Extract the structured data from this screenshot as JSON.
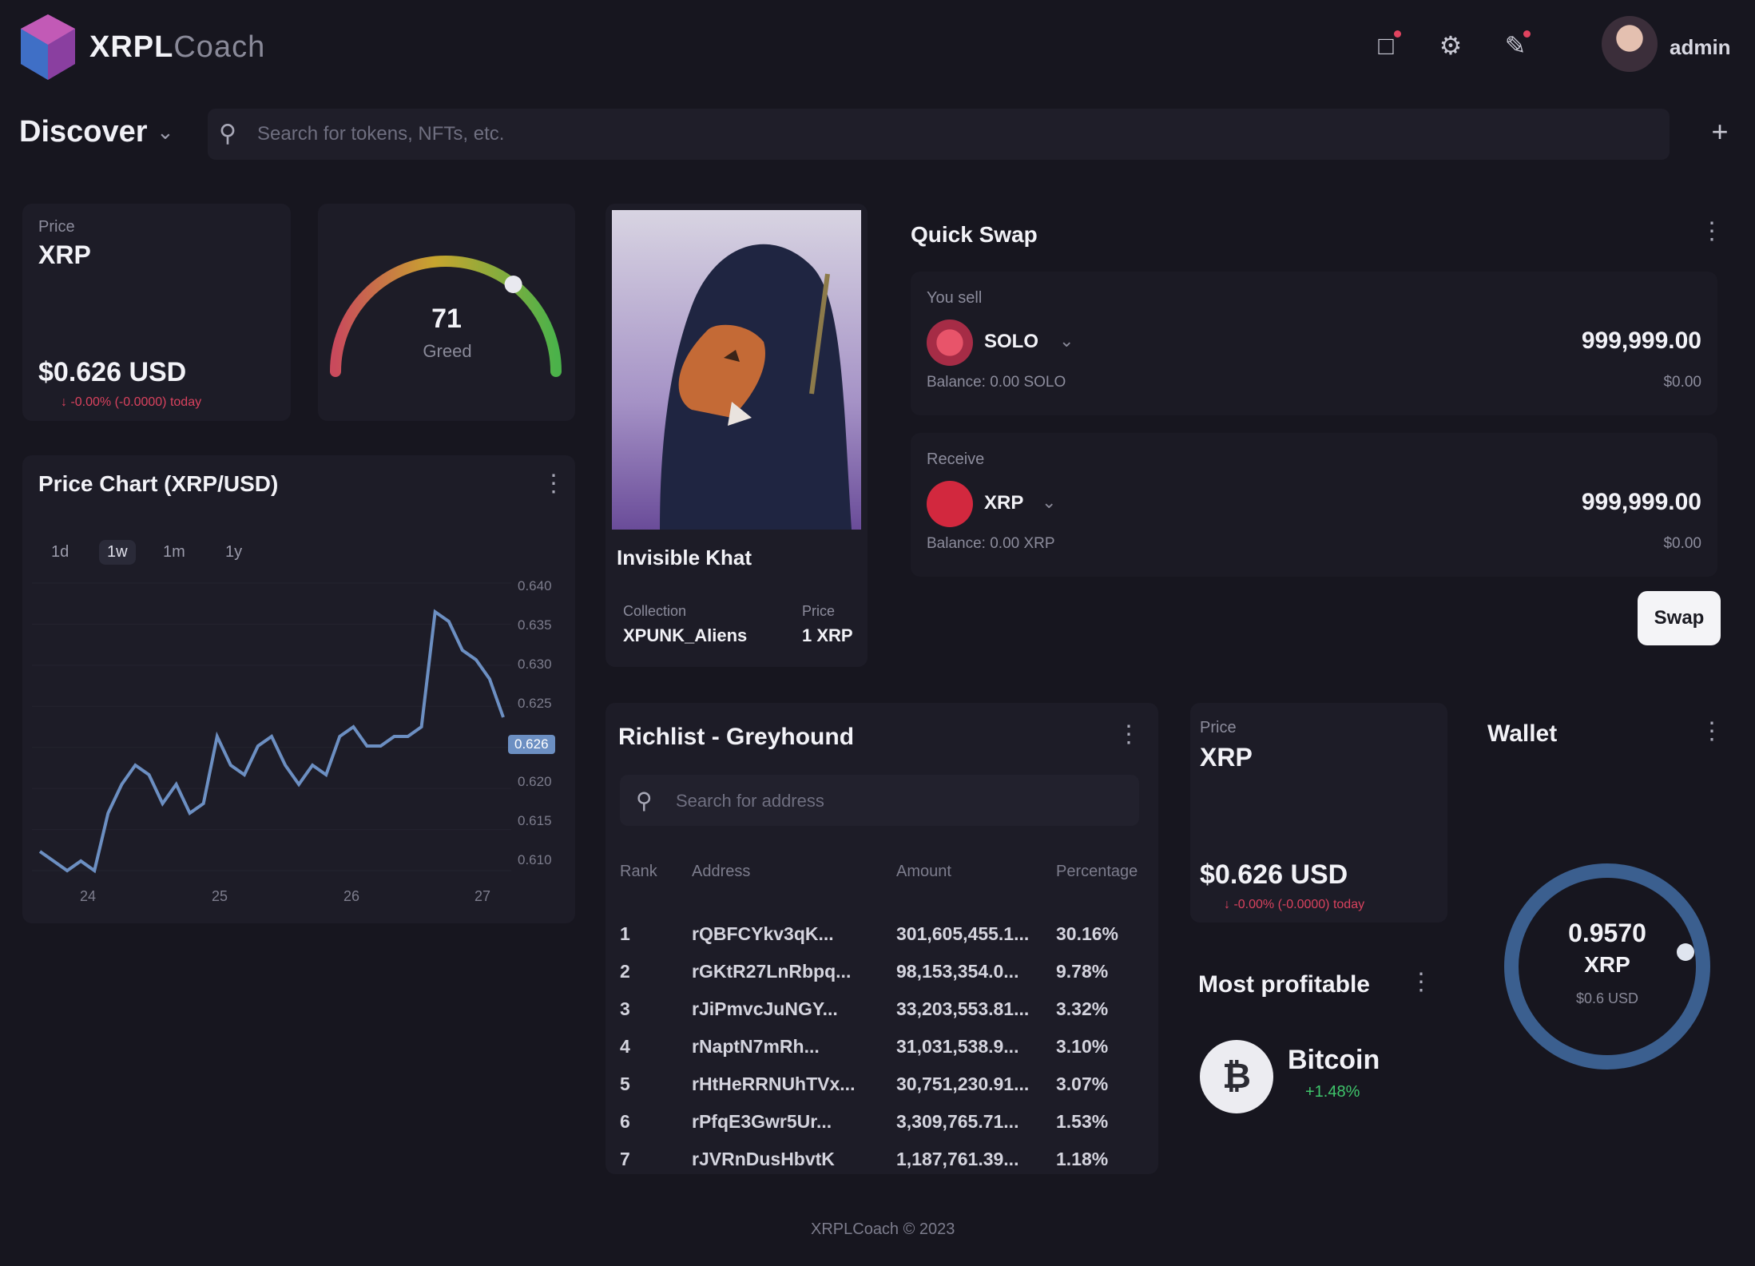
{
  "header": {
    "brand_bold": "XRPL",
    "brand_light": "Coach",
    "username": "admin",
    "icons": [
      "notification-icon",
      "settings-icon",
      "edit-icon"
    ]
  },
  "subbar": {
    "discover_label": "Discover",
    "search_placeholder": "Search for tokens, NFTs, etc."
  },
  "price_card": {
    "label": "Price",
    "symbol": "XRP",
    "value": "$0.626 USD",
    "change": "↓ -0.00% (-0.0000) today"
  },
  "gauge": {
    "value": "71",
    "label": "Greed",
    "level": 0.71
  },
  "price_chart": {
    "title": "Price Chart (XRP/USD)",
    "timeframes": [
      "1d",
      "1w",
      "1m",
      "1y"
    ],
    "active_timeframe": "1w",
    "y_ticks": [
      "0.640",
      "0.635",
      "0.630",
      "0.625",
      "0.626",
      "0.620",
      "0.615",
      "0.610"
    ],
    "highlight_value": "0.626",
    "x_ticks": [
      "24",
      "25",
      "26",
      "27"
    ],
    "color": "#6c8fc2"
  },
  "chart_data": {
    "type": "line",
    "x": [
      0,
      1,
      2,
      3,
      4,
      5,
      6,
      7,
      8,
      9,
      10,
      11,
      12,
      13,
      14,
      15,
      16,
      17,
      18,
      19,
      20,
      21,
      22,
      23,
      24,
      25,
      26,
      27,
      28,
      29,
      30,
      31,
      32,
      33,
      34,
      35,
      36,
      37,
      38,
      39
    ],
    "values": [
      0.612,
      0.611,
      0.61,
      0.611,
      0.61,
      0.616,
      0.619,
      0.621,
      0.62,
      0.617,
      0.619,
      0.616,
      0.617,
      0.624,
      0.621,
      0.62,
      0.623,
      0.624,
      0.621,
      0.619,
      0.621,
      0.62,
      0.624,
      0.625,
      0.623,
      0.623,
      0.624,
      0.624,
      0.625,
      0.637,
      0.636,
      0.633,
      0.632,
      0.63,
      0.626
    ],
    "ylim": [
      0.61,
      0.64
    ],
    "xlabel": "",
    "ylabel": "",
    "title": "Price Chart (XRP/USD)"
  },
  "nft": {
    "name": "Invisible Khat",
    "collection_label": "Collection",
    "collection_value": "XPUNK_Aliens",
    "price_label": "Price",
    "price_value": "1 XRP"
  },
  "swap": {
    "title": "Quick Swap",
    "from_label": "You sell",
    "from_token": "SOLO",
    "from_amount": "999,999.00",
    "from_balance": "Balance: 0.00 SOLO",
    "from_usd": "$0.00",
    "to_label": "Receive",
    "to_token": "XRP",
    "to_amount": "999,999.00",
    "to_balance": "Balance: 0.00 XRP",
    "to_usd": "$0.00",
    "button": "Swap"
  },
  "richlist": {
    "title": "Richlist - Greyhound",
    "search_placeholder": "Search for address",
    "columns": [
      "Rank",
      "Address",
      "Amount",
      "Percentage"
    ],
    "rows": [
      [
        "1",
        "rQBFCYkv3qK...",
        "301,605,455.1...",
        "30.16%"
      ],
      [
        "2",
        "rGKtR27LnRbpq...",
        "98,153,354.0...",
        "9.78%"
      ],
      [
        "3",
        "rJiPmvcJuNGY...",
        "33,203,553.81...",
        "3.32%"
      ],
      [
        "4",
        "rNaptN7mRh...",
        "31,031,538.9...",
        "3.10%"
      ],
      [
        "5",
        "rHtHeRRNUhTVx...",
        "30,751,230.91...",
        "3.07%"
      ],
      [
        "6",
        "rPfqE3Gwr5Ur...",
        "3,309,765.71...",
        "1.53%"
      ],
      [
        "7",
        "rJVRnDusHbvtK",
        "1,187,761.39...",
        "1.18%"
      ]
    ]
  },
  "price_card2": {
    "label": "Price",
    "symbol": "XRP",
    "value": "$0.626 USD",
    "change": "↓ -0.00% (-0.0000) today"
  },
  "profitable": {
    "title": "Most profitable",
    "coin": "Bitcoin",
    "change": "+1.48%"
  },
  "wallet": {
    "title": "Wallet",
    "amount": "0.9570",
    "unit": "XRP",
    "usd": "$0.6 USD",
    "ring_color": "#3b5f8f"
  },
  "footer": "XRPLCoach © 2023"
}
